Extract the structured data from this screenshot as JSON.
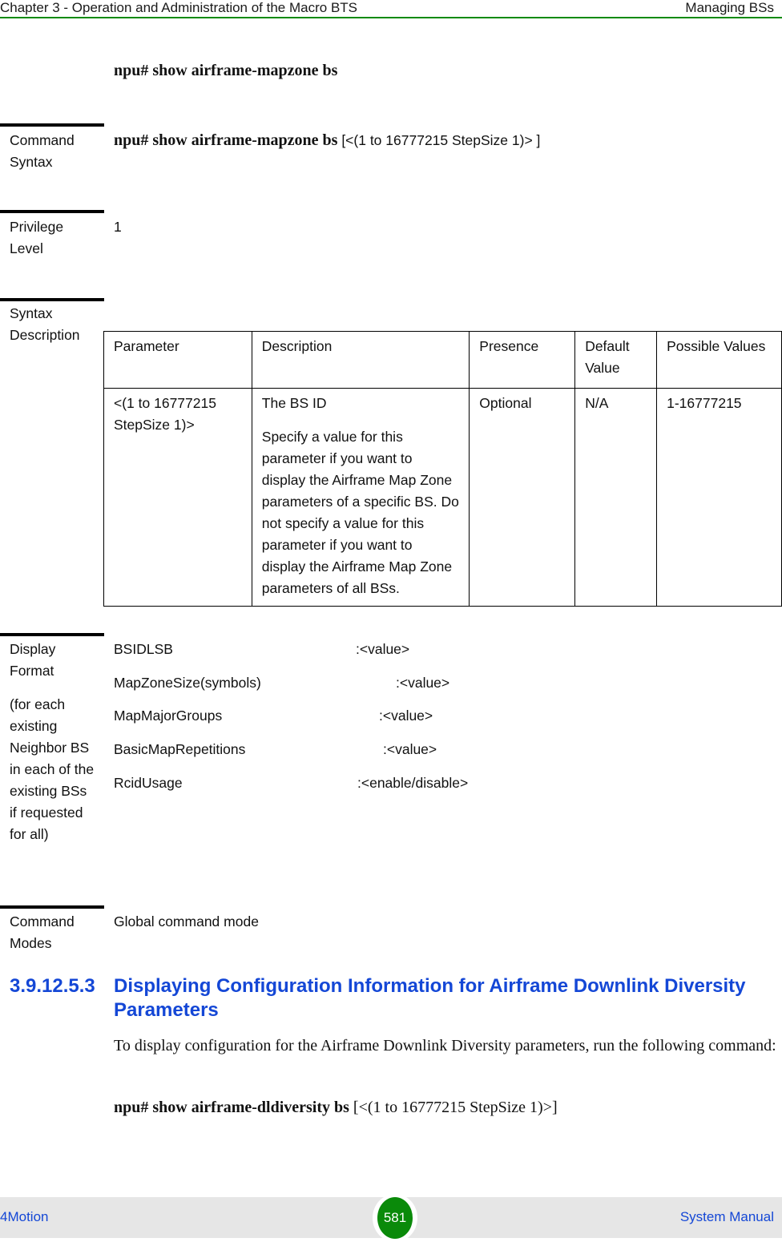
{
  "header": {
    "chapter": "Chapter 3 - Operation and Administration of the Macro BTS",
    "section": "Managing BSs"
  },
  "command_title": "npu# show airframe-mapzone bs",
  "sections": {
    "command_syntax": {
      "label_line1": "Command",
      "label_line2": "Syntax",
      "command": "npu# show airframe-mapzone bs",
      "argument": " [<(1 to 16777215 StepSize 1)> ]"
    },
    "privilege_level": {
      "label_line1": "Privilege",
      "label_line2": "Level",
      "value": "1"
    },
    "syntax_description": {
      "label_line1": "Syntax",
      "label_line2": "Description",
      "table": {
        "headers": [
          "Parameter",
          "Description",
          "Presence",
          "Default Value",
          "Possible Values"
        ],
        "rows": [
          {
            "parameter": "<(1 to 16777215 StepSize 1)>",
            "description_title": "The BS ID",
            "description_body": "Specify a value for this parameter if you want to display the Airframe Map Zone parameters of a specific BS. Do not specify a value for this parameter if you want to display the Airframe Map Zone parameters of all BSs.",
            "presence": "Optional",
            "default_value": "N/A",
            "possible_values": "1-16777215"
          }
        ]
      }
    },
    "display_format": {
      "label_line1": "Display",
      "label_line2": "Format",
      "note": "(for each existing Neighbor BS in each of the existing BSs if requested for all)",
      "fields": [
        {
          "name": "BSIDLSB",
          "value": ":<value>"
        },
        {
          "name": "MapZoneSize(symbols)",
          "value": ":<value>"
        },
        {
          "name": "MapMajorGroups",
          "value": ":<value>"
        },
        {
          "name": "BasicMapRepetitions",
          "value": ":<value>"
        },
        {
          "name": "RcidUsage",
          "value": ":<enable/disable>"
        }
      ]
    },
    "command_modes": {
      "label_line1": "Command",
      "label_line2": "Modes",
      "value": "Global command mode"
    }
  },
  "next_section": {
    "number": "3.9.12.5.3",
    "title": "Displaying Configuration Information for Airframe Downlink Diversity Parameters",
    "paragraph": "To display configuration for the Airframe Downlink Diversity parameters, run the following command:",
    "command": "npu# show airframe-dldiversity bs",
    "argument": " [<(1 to 16777215 StepSize 1)>]"
  },
  "footer": {
    "left": "4Motion",
    "page_number": "581",
    "right": "System Manual"
  },
  "colors": {
    "accent_green": "#0a8a0a",
    "heading_blue": "#1447d6",
    "footer_bg": "#e6e6e6"
  }
}
